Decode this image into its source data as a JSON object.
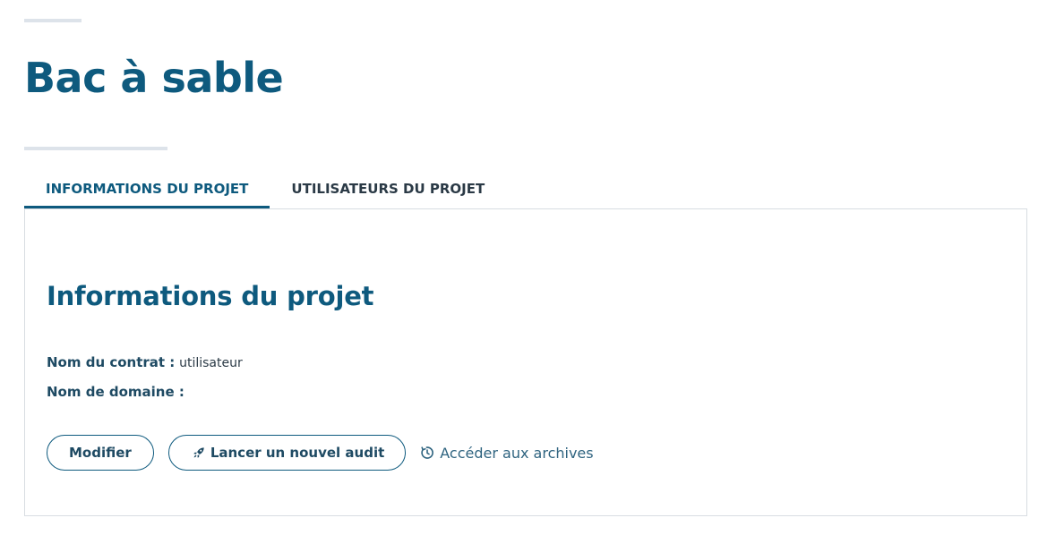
{
  "page": {
    "title": "Bac à sable"
  },
  "tabs": [
    {
      "label": "INFORMATIONS DU PROJET",
      "active": true
    },
    {
      "label": "UTILISATEURS DU PROJET",
      "active": false
    }
  ],
  "section": {
    "title": "Informations du projet",
    "fields": [
      {
        "label": "Nom du contrat :",
        "value": "utilisateur"
      },
      {
        "label": "Nom de domaine :",
        "value": ""
      }
    ]
  },
  "actions": {
    "modify_label": "Modifier",
    "audit_label": "Lancer un nouvel audit",
    "audit_icon": "rocket-icon",
    "archives_label": "Accéder aux archives",
    "archives_icon": "history-icon"
  },
  "colors": {
    "primary": "#0e5a7e",
    "text": "#1e4a63",
    "rule": "#dde3ea",
    "border": "#d8dde2"
  }
}
